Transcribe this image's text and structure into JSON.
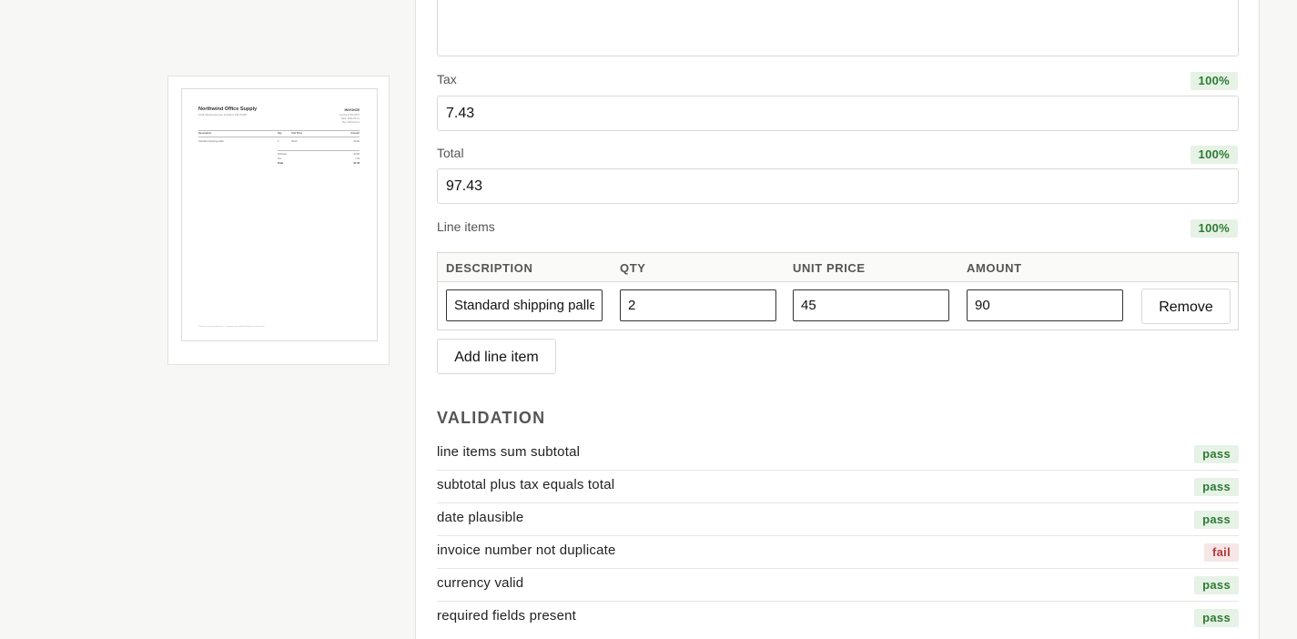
{
  "preview": {
    "company": "Northwind Office Supply",
    "address": "1234 Warehouse Ave, Portland, OR 97205",
    "doc_title": "INVOICE",
    "meta": [
      "Invoice # INV-2047",
      "Date: 2024-01-12",
      "Due: 2024-02-11"
    ],
    "columns": [
      "Description",
      "Qty",
      "Unit Price",
      "Amount"
    ],
    "row": [
      "Standard shipping pallet",
      "2",
      "45.00",
      "90.00"
    ],
    "totals": [
      {
        "label": "Subtotal",
        "value": "90.00"
      },
      {
        "label": "Tax",
        "value": "7.43"
      },
      {
        "label": "Total",
        "value": "97.43"
      }
    ],
    "footer": "Thank you for your business — payment due within 30 days of invoice date."
  },
  "fields": {
    "tax": {
      "label": "Tax",
      "confidence": "100%",
      "value": "7.43"
    },
    "total": {
      "label": "Total",
      "confidence": "100%",
      "value": "97.43"
    },
    "line_items": {
      "label": "Line items",
      "confidence": "100%"
    }
  },
  "line_items": {
    "headers": [
      "DESCRIPTION",
      "QTY",
      "UNIT PRICE",
      "AMOUNT"
    ],
    "rows": [
      {
        "description": "Standard shipping pallet",
        "qty": "2",
        "unit_price": "45",
        "amount": "90"
      }
    ],
    "remove_label": "Remove",
    "add_label": "Add line item"
  },
  "validation": {
    "title": "VALIDATION",
    "checks": [
      {
        "label": "line items sum subtotal",
        "status": "pass"
      },
      {
        "label": "subtotal plus tax equals total",
        "status": "pass"
      },
      {
        "label": "date plausible",
        "status": "pass"
      },
      {
        "label": "invoice number not duplicate",
        "status": "fail"
      },
      {
        "label": "currency valid",
        "status": "pass"
      },
      {
        "label": "required fields present",
        "status": "pass"
      }
    ]
  },
  "colors": {
    "pass_bg": "#e6f2e6",
    "pass_fg": "#2f7a34",
    "fail_bg": "#f7e6e6",
    "fail_fg": "#b03a3a"
  }
}
